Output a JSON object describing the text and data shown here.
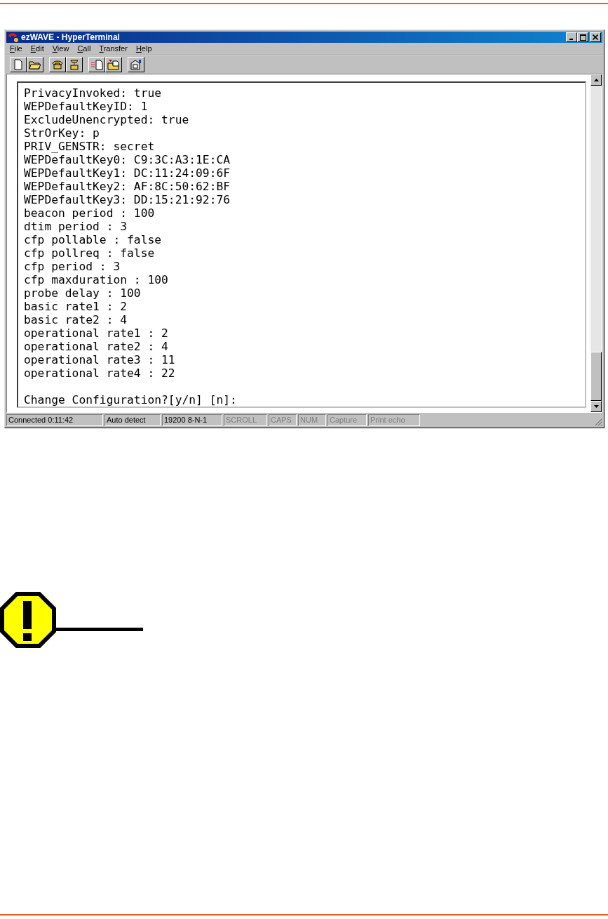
{
  "window": {
    "title": "ezWAVE - HyperTerminal"
  },
  "menu": [
    "File",
    "Edit",
    "View",
    "Call",
    "Transfer",
    "Help"
  ],
  "terminal": {
    "lines": [
      "PrivacyInvoked: true",
      "WEPDefaultKeyID: 1",
      "ExcludeUnencrypted: true",
      "StrOrKey: p",
      "PRIV_GENSTR: secret",
      "WEPDefaultKey0: C9:3C:A3:1E:CA",
      "WEPDefaultKey1: DC:11:24:09:6F",
      "WEPDefaultKey2: AF:8C:50:62:BF",
      "WEPDefaultKey3: DD:15:21:92:76",
      "beacon period : 100",
      "dtim period : 3",
      "cfp pollable : false",
      "cfp pollreq : false",
      "cfp period : 3",
      "cfp maxduration : 100",
      "probe delay : 100",
      "basic rate1 : 2",
      "basic rate2 : 4",
      "operational rate1 : 2",
      "operational rate2 : 4",
      "operational rate3 : 11",
      "operational rate4 : 22"
    ],
    "prompt": "Change Configuration?[y/n] [n]:"
  },
  "status_bar": [
    {
      "label": "Connected 0:11:42",
      "disabled": false
    },
    {
      "label": "Auto detect",
      "disabled": false
    },
    {
      "label": "19200 8-N-1",
      "disabled": false
    },
    {
      "label": "SCROLL",
      "disabled": true
    },
    {
      "label": "CAPS",
      "disabled": true
    },
    {
      "label": "NUM",
      "disabled": true
    },
    {
      "label": "Capture",
      "disabled": true
    },
    {
      "label": "Print echo",
      "disabled": true
    }
  ]
}
